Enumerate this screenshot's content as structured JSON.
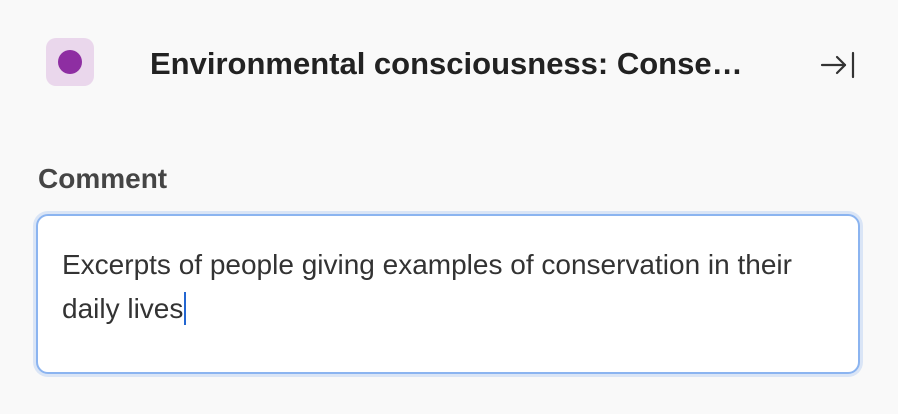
{
  "header": {
    "title": "Environmental consciousness: Conse…",
    "icons": {
      "code_color": "code-color-icon",
      "collapse": "collapse-right-icon"
    }
  },
  "comment": {
    "label": "Comment",
    "value": "Excerpts of people giving examples of conservation in their daily lives"
  },
  "colors": {
    "background": "#f9f9f9",
    "code_badge": "#ead7ec",
    "code_dot": "#8e2ea2",
    "focus_border": "#8bb4f0",
    "caret": "#2366d1"
  }
}
